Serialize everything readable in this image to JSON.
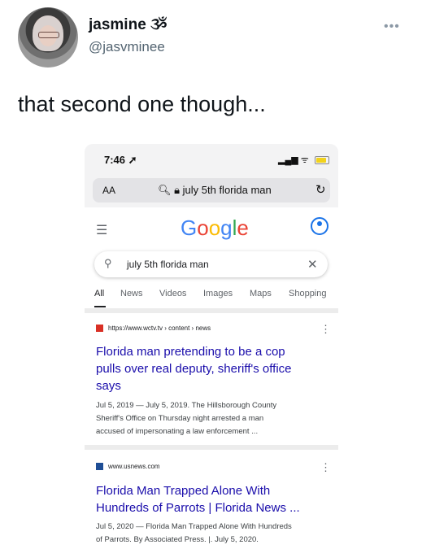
{
  "tweet": {
    "display_name": "jasmine ૐ",
    "handle": "@jasvminee",
    "more": "•••",
    "text": "that second one though..."
  },
  "phone": {
    "time": "7:46 ➚",
    "status_icons": "▂▄▆ ᯤ",
    "address_aa": "AA",
    "address_url": "🔍︎ 🔒︎ july 5th florida man",
    "reload": "↻"
  },
  "google": {
    "menu_icon": "☰",
    "logo_letters": [
      "G",
      "o",
      "o",
      "g",
      "l",
      "e"
    ],
    "logo_colors": [
      "#4285F4",
      "#EA4335",
      "#FBBC05",
      "#4285F4",
      "#34A853",
      "#EA4335"
    ],
    "search_query": "july 5th florida man",
    "search_icon": "⚲",
    "clear_icon": "✕",
    "tabs": [
      "All",
      "News",
      "Videos",
      "Images",
      "Maps",
      "Shopping"
    ],
    "active_tab": "All"
  },
  "results": [
    {
      "cite": "https://www.wctv.tv › content › news",
      "favicon_color": "#d93025",
      "title_lines": [
        "Florida man pretending to be a cop",
        "pulls over real deputy, sheriff's office",
        "says"
      ],
      "snippet_lines": [
        "Jul 5, 2019 — July 5, 2019. The Hillsborough County",
        "Sheriff's Office on Thursday night arrested a man",
        "accused of impersonating a law enforcement ..."
      ],
      "more": "⋮"
    },
    {
      "cite": "www.usnews.com",
      "favicon_color": "#1f4e96",
      "title_lines": [
        "Florida Man Trapped Alone With",
        "Hundreds of Parrots | Florida News ..."
      ],
      "snippet_lines": [
        "Jul 5, 2020 — Florida Man Trapped Alone With Hundreds",
        "of Parrots. By Associated Press. |. July 5, 2020."
      ],
      "more": "⋮"
    }
  ]
}
